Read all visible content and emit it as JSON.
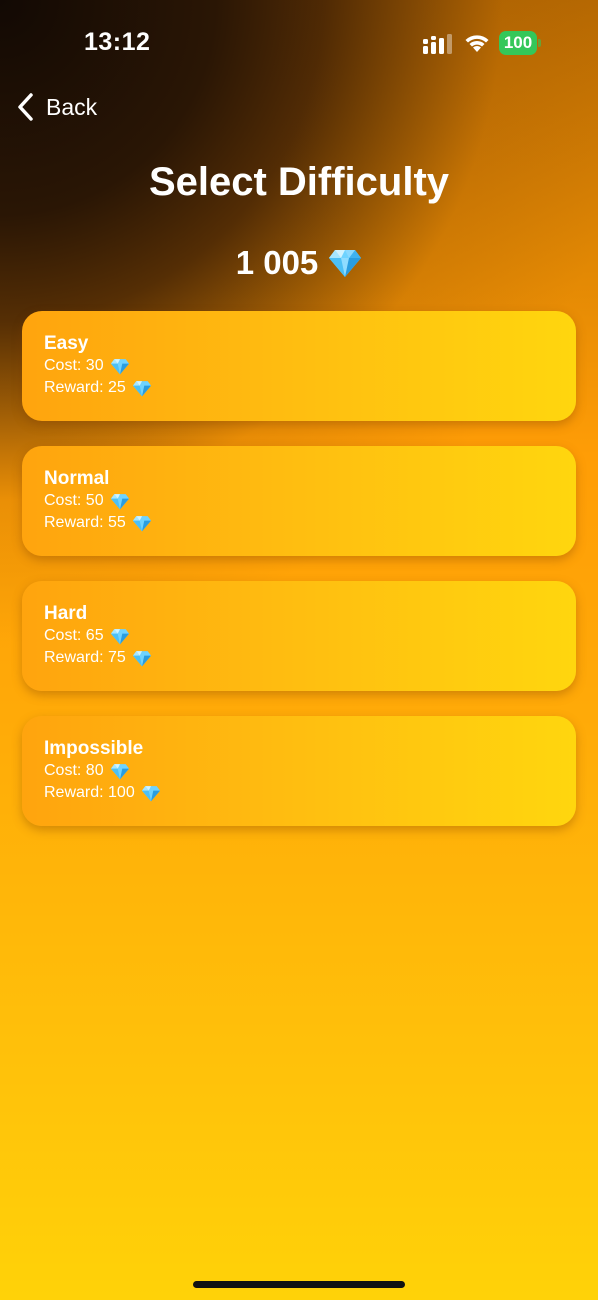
{
  "status_bar": {
    "time": "13:12",
    "battery": "100"
  },
  "nav": {
    "back_label": "Back"
  },
  "header": {
    "title": "Select Difficulty",
    "balance": "1 005"
  },
  "difficulties": [
    {
      "name": "Easy",
      "cost": "Cost: 30",
      "reward": "Reward: 25"
    },
    {
      "name": "Normal",
      "cost": "Cost: 50",
      "reward": "Reward: 55"
    },
    {
      "name": "Hard",
      "cost": "Cost: 65",
      "reward": "Reward: 75"
    },
    {
      "name": "Impossible",
      "cost": "Cost: 80",
      "reward": "Reward: 100"
    }
  ],
  "icons": {
    "currency": "diamond-icon",
    "back": "chevron-left-icon"
  },
  "colors": {
    "battery": "#34c759",
    "card_start": "#ffa40e",
    "card_end": "#ffd60e"
  }
}
